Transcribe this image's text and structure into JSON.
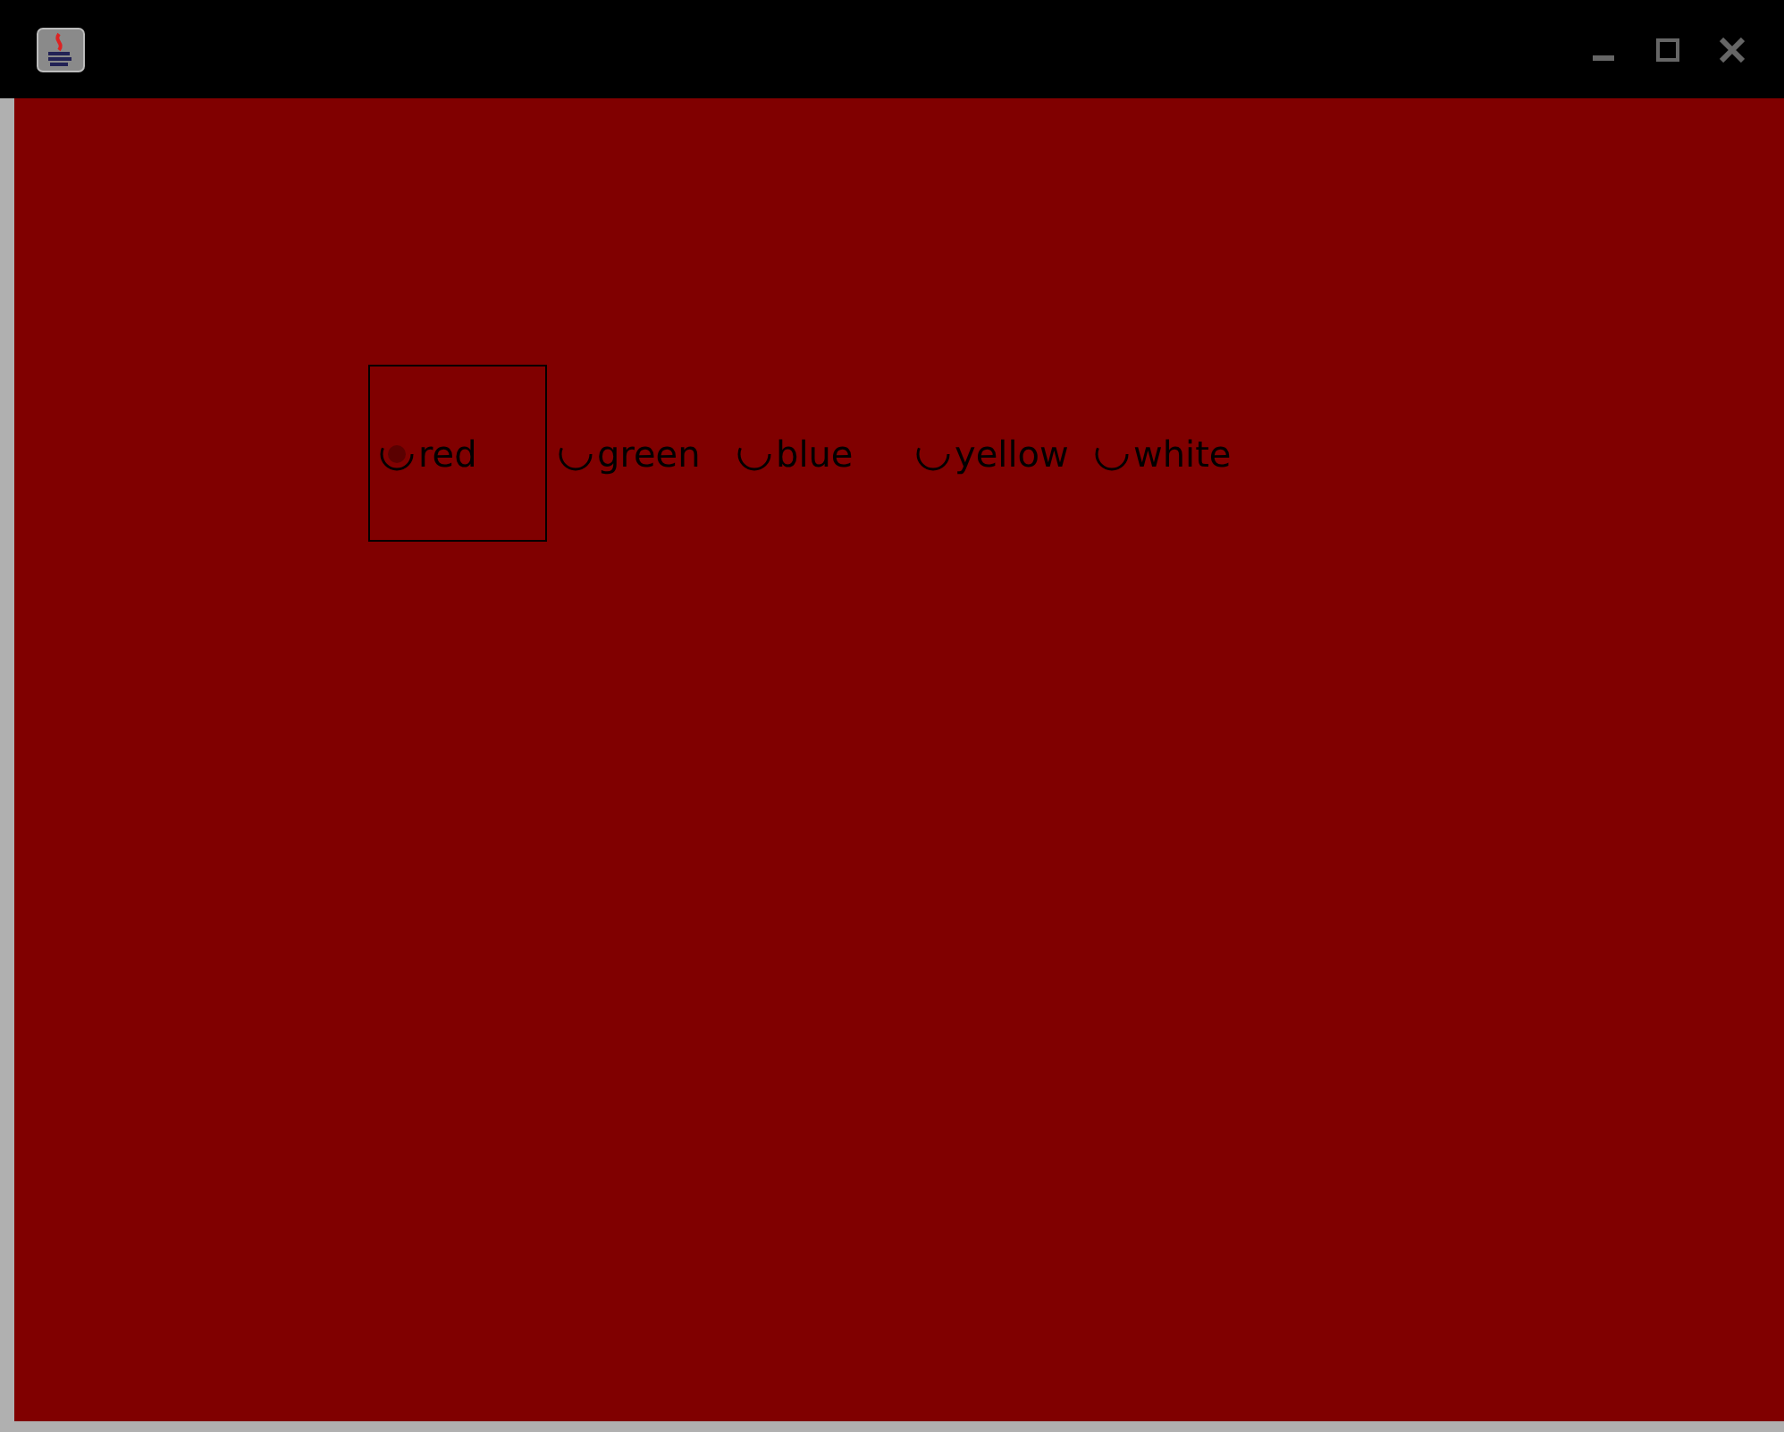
{
  "options": [
    {
      "label": "red",
      "selected": true,
      "focused": true
    },
    {
      "label": "green",
      "selected": false,
      "focused": false
    },
    {
      "label": "blue",
      "selected": false,
      "focused": false
    },
    {
      "label": "yellow",
      "selected": false,
      "focused": false
    },
    {
      "label": "white",
      "selected": false,
      "focused": false
    }
  ]
}
